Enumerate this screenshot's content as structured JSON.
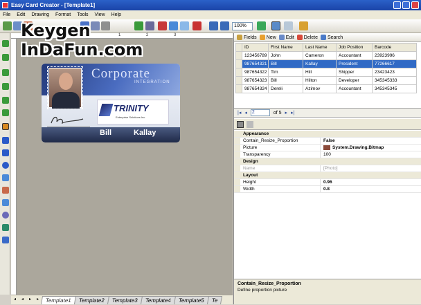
{
  "window": {
    "title": "Easy Card Creator - [Template1]"
  },
  "menu": [
    "File",
    "Edit",
    "Drawing",
    "Format",
    "Tools",
    "View",
    "Help"
  ],
  "toolbar": {
    "zoom": "100%"
  },
  "ruler": {
    "marks": [
      "1",
      "2",
      "3"
    ]
  },
  "card": {
    "heading": "Corporate",
    "subheading": "INTEGRATION",
    "logo_name": "TRINITY",
    "logo_sub": "Enterprise Solutions Inc.",
    "first_name": "Bill",
    "last_name": "Kallay"
  },
  "template_tabs": [
    "Template1",
    "Template2",
    "Template3",
    "Template4",
    "Template5",
    "Te"
  ],
  "grid_toolbar": {
    "fields": "Fields",
    "new": "New",
    "edit": "Edit",
    "delete": "Delete",
    "search": "Search"
  },
  "grid": {
    "columns": [
      "ID",
      "First Name",
      "Last Name",
      "Job Position",
      "Barcode"
    ],
    "rows": [
      [
        "123456789",
        "John",
        "Cameron",
        "Accountant",
        "23923996"
      ],
      [
        "987654321",
        "Bill",
        "Kallay",
        "President",
        "77266617"
      ],
      [
        "987654322",
        "Tim",
        "Hill",
        "Shipper",
        "23423423"
      ],
      [
        "987654323",
        "Bill",
        "Hilton",
        "Developer",
        "345345333"
      ],
      [
        "987654324",
        "Dereli",
        "Azimov",
        "Accountant",
        "345345345"
      ]
    ],
    "selected_row": 1
  },
  "navigator": {
    "page": "2",
    "of": "of 5"
  },
  "properties": [
    {
      "type": "cat",
      "k": "Appearance"
    },
    {
      "type": "row",
      "k": "Contain_Resize_Proportion",
      "v": "False"
    },
    {
      "type": "row",
      "k": "Picture",
      "v": "System.Drawing.Bitmap"
    },
    {
      "type": "row",
      "k": "Transparency",
      "v": "100"
    },
    {
      "type": "cat",
      "k": "Design"
    },
    {
      "type": "row",
      "k": "Name",
      "v": "[Photo]"
    },
    {
      "type": "cat",
      "k": "Layout"
    },
    {
      "type": "row",
      "k": "Height",
      "v": "0.96"
    },
    {
      "type": "row",
      "k": "Width",
      "v": "0.8"
    }
  ],
  "help": {
    "title": "Contain_Resize_Proportion",
    "desc": "Define proportion picture"
  },
  "watermark": [
    "Keygen",
    "InDaFun.com"
  ],
  "colors": {
    "titlebar": "#1a44a8",
    "selection": "#316ac5",
    "canvas": "#aba79c"
  }
}
